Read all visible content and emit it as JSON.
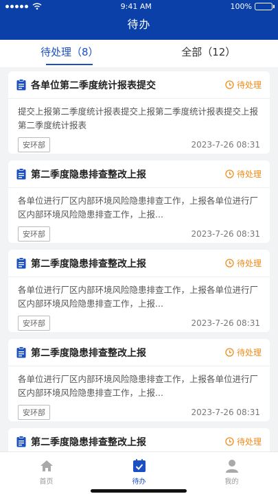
{
  "status_bar": {
    "time": "9:41 AM",
    "battery": "100%"
  },
  "nav": {
    "title": "待办"
  },
  "tabs": [
    {
      "label": "待处理（8）"
    },
    {
      "label": "全部（12）"
    }
  ],
  "cards": [
    {
      "title": "各单位第二季度统计报表提交",
      "status": "待处理",
      "body": "提交上报第二季度统计报表提交上报第二季度统计报表提交上报第二季度统计报表",
      "dept": "安环部",
      "date": "2023-7-26  08:31"
    },
    {
      "title": "第二季度隐患排查整改上报",
      "status": "待处理",
      "body": "各单位进行厂区内部环境风险隐患排查工作，上报各单位进行厂区内部环境风险隐患排查工作，上报...",
      "dept": "安环部",
      "date": "2023-7-26  08:31"
    },
    {
      "title": "第二季度隐患排查整改上报",
      "status": "待处理",
      "body": "各单位进行厂区内部环境风险隐患排查工作，上报各单位进行厂区内部环境风险隐患排查工作，上报...",
      "dept": "安环部",
      "date": "2023-7-26  08:31"
    },
    {
      "title": "第二季度隐患排查整改上报",
      "status": "待处理",
      "body": "各单位进行厂区内部环境风险隐患排查工作，上报各单位进行厂区内部环境风险隐患排查工作，上报...",
      "dept": "安环部",
      "date": "2023-7-26  08:31"
    },
    {
      "title": "第二季度隐患排查整改上报",
      "status": "待处理",
      "body": "",
      "dept": "",
      "date": ""
    }
  ],
  "tabbar": [
    {
      "label": "首页",
      "icon": "home-icon"
    },
    {
      "label": "待办",
      "icon": "todo-check-icon"
    },
    {
      "label": "我的",
      "icon": "user-icon"
    }
  ],
  "colors": {
    "primary": "#0a40a8",
    "accent": "#1b4fc2",
    "pending": "#f08c1a"
  }
}
